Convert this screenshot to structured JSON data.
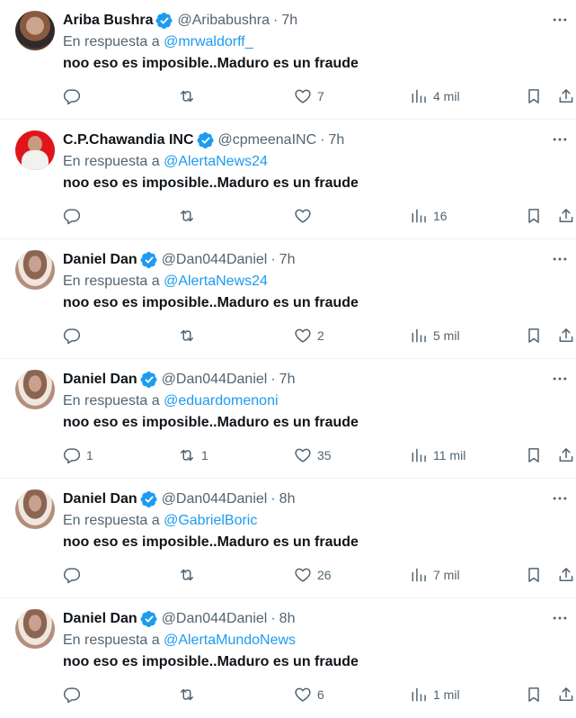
{
  "reply_prefix": "En respuesta a",
  "tweets": [
    {
      "name": "Ariba Bushra",
      "handle": "@Aribabushra",
      "time": "7h",
      "mention": "@mrwaldorff_",
      "text": "noo eso es imposible..Maduro es un fraude",
      "replies": "",
      "retweets": "",
      "likes": "7",
      "views": "4 mil",
      "avatar": "av-a"
    },
    {
      "name": "C.P.Chawandia INC",
      "handle": "@cpmeenaINC",
      "time": "7h",
      "mention": "@AlertaNews24",
      "text": "noo eso es imposible..Maduro es un fraude",
      "replies": "",
      "retweets": "",
      "likes": "",
      "views": "16",
      "avatar": "av-b"
    },
    {
      "name": "Daniel Dan",
      "handle": "@Dan044Daniel",
      "time": "7h",
      "mention": "@AlertaNews24",
      "text": "noo eso es imposible..Maduro es un fraude",
      "replies": "",
      "retweets": "",
      "likes": "2",
      "views": "5 mil",
      "avatar": "av-c"
    },
    {
      "name": "Daniel Dan",
      "handle": "@Dan044Daniel",
      "time": "7h",
      "mention": "@eduardomenoni",
      "text": "noo eso es imposible..Maduro es un fraude",
      "replies": "1",
      "retweets": "1",
      "likes": "35",
      "views": "11 mil",
      "avatar": "av-c"
    },
    {
      "name": "Daniel Dan",
      "handle": "@Dan044Daniel",
      "time": "8h",
      "mention": "@GabrielBoric",
      "text": "noo eso es imposible..Maduro es un fraude",
      "replies": "",
      "retweets": "",
      "likes": "26",
      "views": "7 mil",
      "avatar": "av-c"
    },
    {
      "name": "Daniel Dan",
      "handle": "@Dan044Daniel",
      "time": "8h",
      "mention": "@AlertaMundoNews",
      "text": "noo eso es imposible..Maduro es un fraude",
      "replies": "",
      "retweets": "",
      "likes": "6",
      "views": "1 mil",
      "avatar": "av-c"
    }
  ],
  "colors": {
    "accent": "#1d9bf0",
    "secondary_text": "#536471",
    "primary_text": "#0f1419",
    "divider": "#eff3f4"
  },
  "icons": {
    "verified": "verified-badge-icon",
    "more": "more-options-icon",
    "reply": "reply-icon",
    "retweet": "retweet-icon",
    "like": "heart-icon",
    "views": "views-chart-icon",
    "bookmark": "bookmark-icon",
    "share": "share-icon"
  }
}
